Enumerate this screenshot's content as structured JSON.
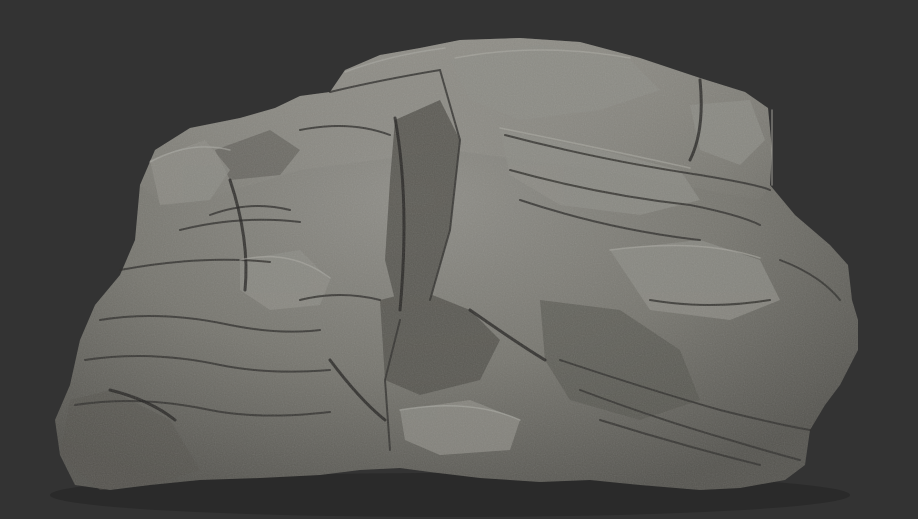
{
  "viewport": {
    "background_color": "#333333"
  },
  "sculpt": {
    "subject": "rock-cliff-sculpt",
    "material": "matte-clay",
    "colors": {
      "base": "#7c7b76",
      "highlight": "#a3a29b",
      "mid": "#6b6a65",
      "shadow": "#3c3b38",
      "deep_crevice": "#262523"
    }
  }
}
